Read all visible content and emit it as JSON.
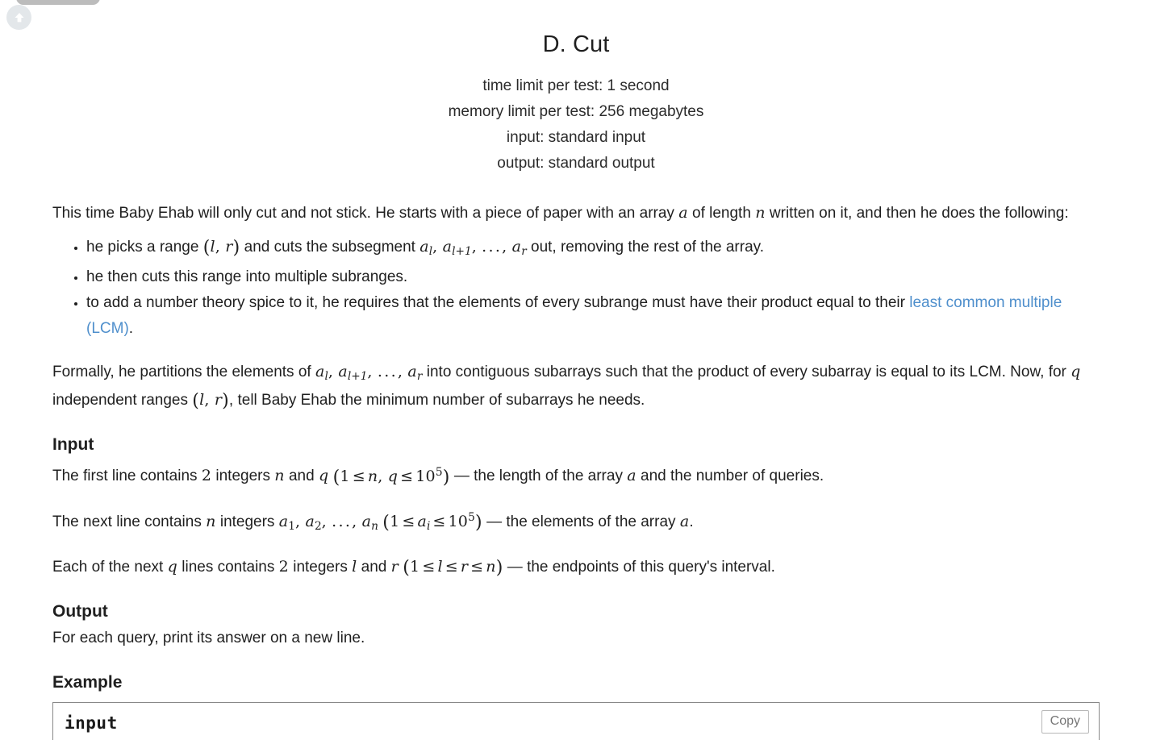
{
  "window": {
    "scroll_top_icon": "arrow-up-icon"
  },
  "problem": {
    "title": "D. Cut",
    "limits": [
      "time limit per test: 1 second",
      "memory limit per test: 256 megabytes",
      "input: standard input",
      "output: standard output"
    ]
  },
  "statement": {
    "intro_1": "This time Baby Ehab will only cut and not stick. He starts with a piece of paper with an array ",
    "intro_a": "a",
    "intro_2": " of length ",
    "intro_n": "n",
    "intro_3": " written on it, and then he does the following:",
    "bullets": [
      {
        "pre": "he picks a range ",
        "math_lr": "(l, r)",
        "mid": " and cuts the subsegment ",
        "math_seq": "a_l, a_{l+1}, ..., a_r",
        "post": " out, removing the rest of the array."
      },
      {
        "pre": "he then cuts this range into multiple subranges.",
        "math_lr": "",
        "mid": "",
        "math_seq": "",
        "post": ""
      },
      {
        "pre": "to add a number theory spice to it, he requires that the elements of every subrange must have their product equal to their ",
        "link_text": "least common multiple (LCM)",
        "post": "."
      }
    ],
    "formal_1": "Formally, he partitions the elements of ",
    "formal_seq": "a_l, a_{l+1}, ..., a_r",
    "formal_2": " into contiguous subarrays such that the product of every subarray is equal to its LCM. Now, for ",
    "formal_q": "q",
    "formal_3": " independent ranges ",
    "formal_lr": "(l, r)",
    "formal_4": ", tell Baby Ehab the minimum number of subarrays he needs."
  },
  "input_section": {
    "heading": "Input",
    "line1_a": "The first line contains ",
    "line1_two": "2",
    "line1_b": " integers ",
    "line1_n": "n",
    "line1_c": " and ",
    "line1_q": "q",
    "line1_constraint": "(1 ≤ n, q ≤ 10^5)",
    "line1_d": " — the length of the array ",
    "line1_a_var": "a",
    "line1_e": " and the number of queries.",
    "line2_a": "The next line contains ",
    "line2_n": "n",
    "line2_b": " integers ",
    "line2_seq": "a_1, a_2, ..., a_n",
    "line2_constraint": "(1 ≤ a_i ≤ 10^5)",
    "line2_c": " — the elements of the array ",
    "line2_a_var": "a",
    "line2_d": ".",
    "line3_a": "Each of the next ",
    "line3_q": "q",
    "line3_b": " lines contains ",
    "line3_two": "2",
    "line3_c": " integers ",
    "line3_l": "l",
    "line3_d": " and ",
    "line3_r": "r",
    "line3_constraint": "(1 ≤ l ≤ r ≤ n)",
    "line3_e": " — the endpoints of this query's interval."
  },
  "output_section": {
    "heading": "Output",
    "text": "For each query, print its answer on a new line."
  },
  "example_section": {
    "heading": "Example",
    "input_label": "input",
    "copy_label": "Copy"
  },
  "colors": {
    "link": "#4f8fcc",
    "text": "#1f1f1f",
    "border": "#888888",
    "copy_border": "#b7b7b7",
    "scroll_btn_bg": "#e3e7ea",
    "top_tab": "#bcbcbc"
  }
}
